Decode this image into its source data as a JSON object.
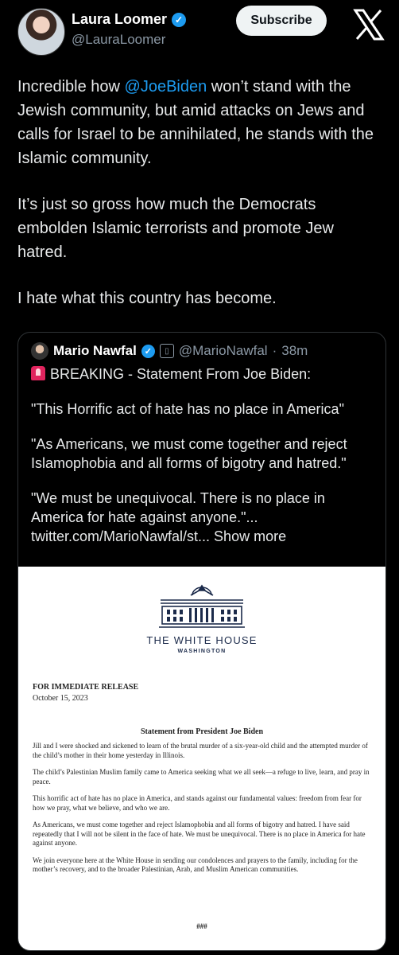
{
  "author": {
    "name": "Laura Loomer",
    "handle": "@LauraLoomer",
    "subscribe_label": "Subscribe"
  },
  "tweet": {
    "p1_prefix": "Incredible how ",
    "p1_mention": "@JoeBiden",
    "p1_suffix": " won’t stand with the Jewish community, but amid attacks on Jews and calls for Israel to be annihilated, he stands with the Islamic community.",
    "p2": "It’s just so gross how much the Democrats embolden Islamic terrorists and promote Jew hatred.",
    "p3": "I hate what this country has become."
  },
  "quote": {
    "name": "Mario Nawfal",
    "handle": "@MarioNawfal",
    "sep": "·",
    "time": "38m",
    "line1": "BREAKING - Statement From Joe Biden:",
    "line2": "\"This Horrific act of hate has no place in America\"",
    "line3": "\"As Americans, we must come together and reject Islamophobia and all forms of bigotry and hatred.\"",
    "line4": "\"We must be unequivocal. There is no place in America for hate against anyone.\"... twitter.com/MarioNawfal/st... Show more"
  },
  "document": {
    "org": "THE WHITE HOUSE",
    "city": "WASHINGTON",
    "release": "FOR IMMEDIATE RELEASE",
    "date": "October 15, 2023",
    "title": "Statement from President Joe Biden",
    "para1": "Jill and I were shocked and sickened to learn of the brutal murder of a six-year-old child and the attempted murder of the child’s mother in their home yesterday in Illinois.",
    "para2": "The child’s Palestinian Muslim family came to America seeking what we all seek—a refuge to live, learn, and pray in peace.",
    "para3": "This horrific act of hate has no place in America, and stands against our fundamental values: freedom from fear for how we pray, what we believe, and who we are.",
    "para4": "As Americans, we must come together and reject Islamophobia and all forms of bigotry and hatred.  I have said repeatedly that I will not be silent in the face of hate.  We must be unequivocal. There is no place in America for hate against anyone.",
    "para5": "We join everyone here at the White House in sending our condolences and prayers to the family, including for the mother’s recovery, and to the broader Palestinian, Arab, and Muslim American communities.",
    "end": "###"
  },
  "colors": {
    "background": "#000000",
    "link": "#1d9bf0",
    "verified": "#1d9bf0",
    "muted": "#8b98a5"
  },
  "icons": [
    "verified-badge-icon",
    "x-logo-icon",
    "siren-icon",
    "white-house-logo"
  ]
}
